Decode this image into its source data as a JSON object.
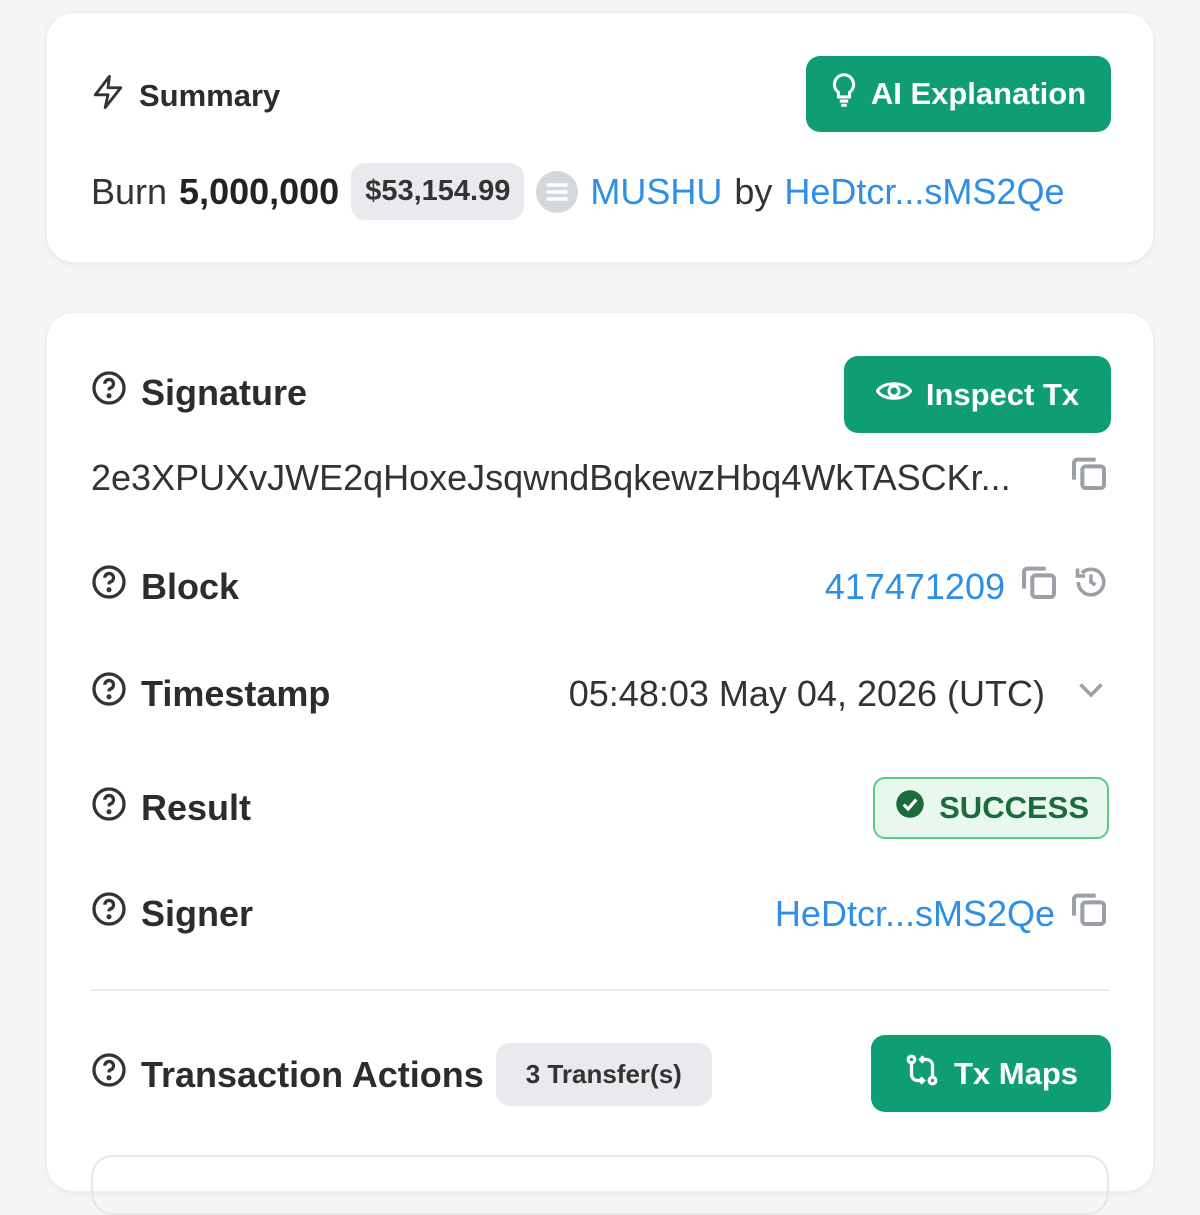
{
  "summary": {
    "title": "Summary",
    "ai_button_label": "AI Explanation",
    "action": "Burn",
    "amount": "5,000,000",
    "usd_value": "$53,154.99",
    "token": "MUSHU",
    "by_label": "by",
    "signer_short": "HeDtcr...sMS2Qe"
  },
  "details": {
    "signature_label": "Signature",
    "inspect_button_label": "Inspect Tx",
    "signature_value": "2e3XPUXvJWE2qHoxeJsqwndBqkewzHbq4WkTASCKr...",
    "block_label": "Block",
    "block_value": "417471209",
    "timestamp_label": "Timestamp",
    "timestamp_value": "05:48:03 May 04, 2026 (UTC)",
    "result_label": "Result",
    "result_value": "SUCCESS",
    "signer_label": "Signer",
    "signer_value": "HeDtcr...sMS2Qe",
    "actions_label": "Transaction Actions",
    "transfers_count": "3 Transfer(s)",
    "tx_maps_label": "Tx Maps"
  },
  "colors": {
    "accent_green": "#0f9d74",
    "link_blue": "#2f8ee6",
    "success_border": "#5cc98a"
  },
  "icons": [
    "lightning-icon",
    "lightbulb-icon",
    "token-icon",
    "help-icon",
    "eye-icon",
    "copy-icon",
    "history-icon",
    "chevron-down-icon",
    "check-circle-icon",
    "transfer-arrows-icon"
  ]
}
